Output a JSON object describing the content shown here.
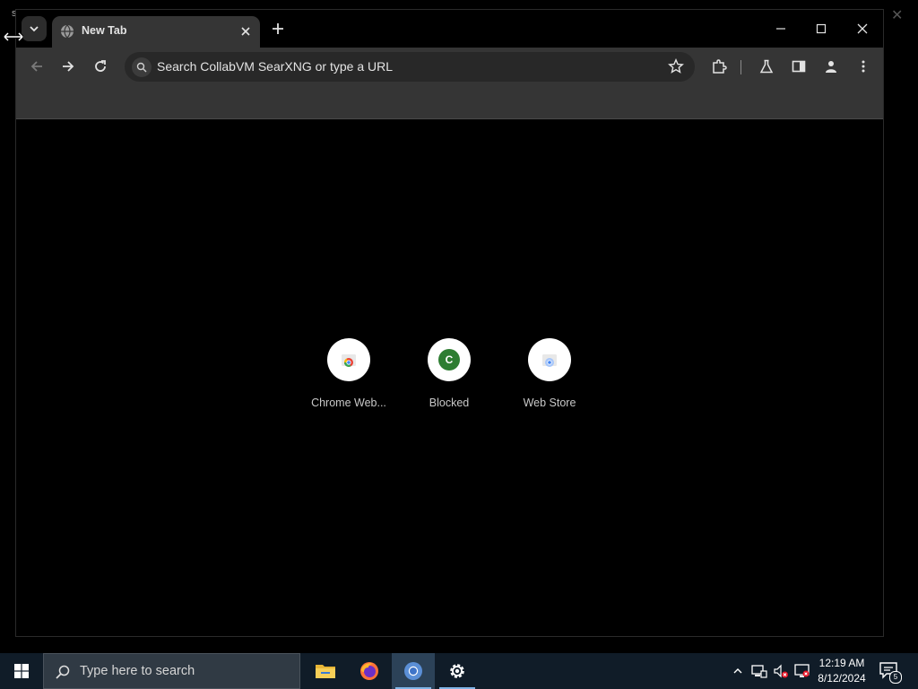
{
  "desktop": {
    "stray_char": "s"
  },
  "browser": {
    "tab": {
      "title": "New Tab"
    },
    "omnibox": {
      "placeholder": "Search CollabVM SearXNG or type a URL"
    },
    "shortcuts": [
      {
        "label": "Chrome Web...",
        "icon": "chrome-web-store-icon"
      },
      {
        "label": "Blocked",
        "icon": "letter-c-icon",
        "letter": "C",
        "color": "#2e7d32"
      },
      {
        "label": "Web Store",
        "icon": "web-store-icon"
      }
    ]
  },
  "taskbar": {
    "search_placeholder": "Type here to search",
    "apps": [
      "file-explorer",
      "firefox",
      "chrome",
      "settings"
    ],
    "active_app": "chrome",
    "clock": {
      "time": "12:19 AM",
      "date": "8/12/2024"
    },
    "notification_count": "5"
  },
  "colors": {
    "tab_active": "#353535",
    "toolbar": "#353535",
    "omnibox": "#282828",
    "taskbar": "#101c28",
    "accent": "#7fb4e6"
  }
}
